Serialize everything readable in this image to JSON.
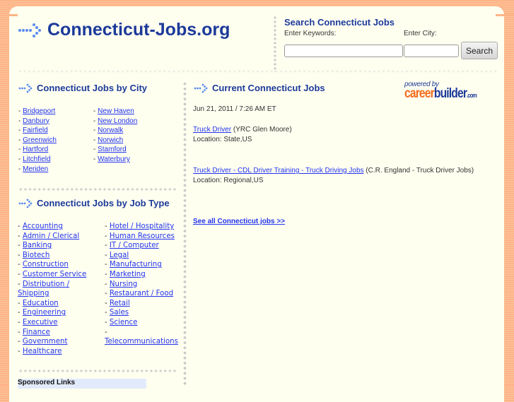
{
  "site": {
    "title": "Connecticut-Jobs.org"
  },
  "search": {
    "title": "Search Connecticut Jobs",
    "keywords_label": "Enter Keywords:",
    "keywords_value": "",
    "city_label": "Enter City:",
    "city_value": "",
    "button_label": "Search"
  },
  "by_city": {
    "title": "Connecticut Jobs by City",
    "col1": [
      "Bridgeport",
      "Danbury",
      "Fairfield",
      "Greenwich",
      "Hartford",
      "Litchfield",
      "Meriden"
    ],
    "col2": [
      "New Haven",
      "New London",
      "Norwalk",
      "Norwich",
      "Stamford",
      "Waterbury"
    ]
  },
  "by_type": {
    "title": "Connecticut Jobs by Job Type",
    "col1": [
      "Accounting",
      "Admin / Clerical",
      "Banking",
      "Biotech",
      "Construction",
      "Customer Service",
      "Distribution / Shipping",
      "Education",
      "Engineering",
      "Executive",
      "Finance",
      "Government",
      "Healthcare"
    ],
    "col2": [
      "Hotel / Hospitality",
      "Human Resources",
      "IT / Computer",
      "Legal",
      "Manufacturing",
      "Marketing",
      "Nursing",
      "Restaurant / Food",
      "Retail",
      "Sales",
      "Science",
      "Telecommunications"
    ]
  },
  "sponsored": {
    "title": "Sponsored Links"
  },
  "current": {
    "title": "Current Connecticut Jobs",
    "timestamp": "Jun 21, 2011 / 7:26 AM ET",
    "jobs": [
      {
        "title": "Truck Driver",
        "company": "(YRC Glen Moore)",
        "location": "Location: State,US"
      },
      {
        "title": "Truck Driver - CDL Driver Training - Truck Driving Jobs",
        "company": "(C.R. England - Truck Driver Jobs)",
        "location": "Location: Regional,US"
      }
    ],
    "see_all": "See all Connecticut jobs >>"
  },
  "powered_by": {
    "prefix": "powered by",
    "brand_a": "career",
    "brand_b": "builder",
    "brand_suffix": ".com"
  },
  "colors": {
    "brand_blue": "#1c3a9a",
    "link": "#2233ee",
    "background": "#fffff0",
    "frame": "#fdb486",
    "accent_orange": "#f26a1b"
  }
}
